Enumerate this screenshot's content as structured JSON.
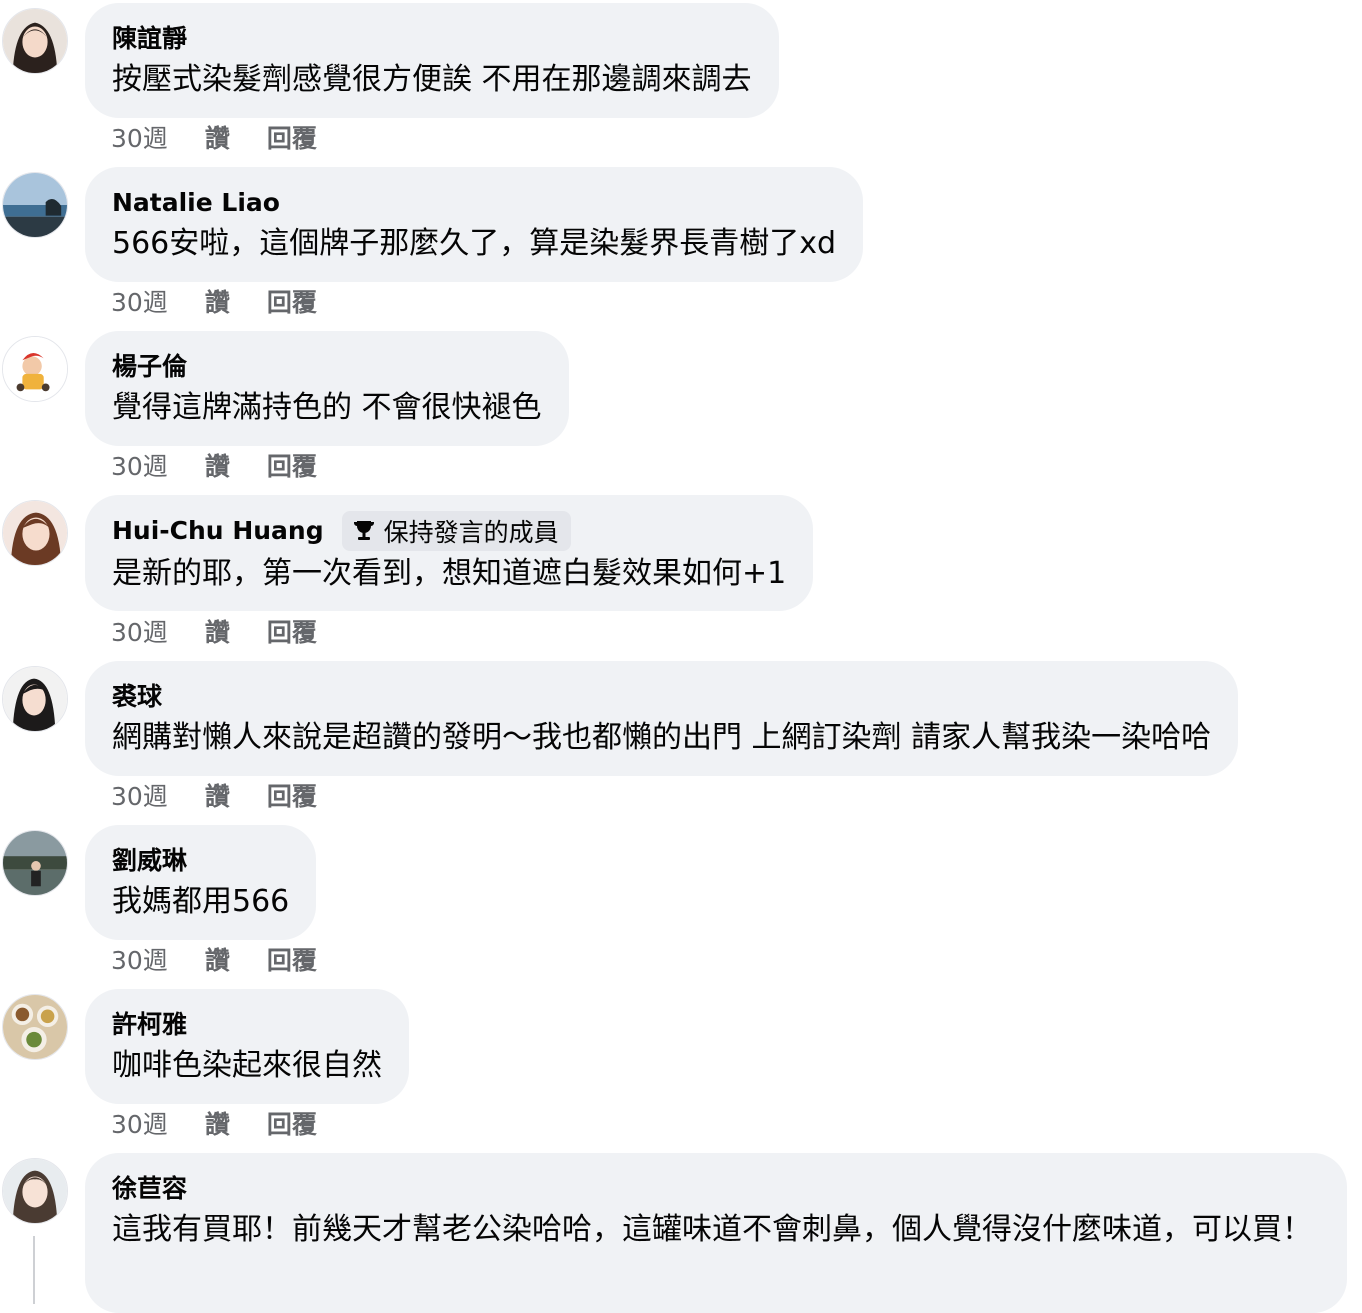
{
  "comments": [
    {
      "author": "陳誼靜",
      "text": "按壓式染髮劑感覺很方便誒 不用在那邊調來調去",
      "time": "30週",
      "like_label": "讚",
      "reply_label": "回覆",
      "avatar": "avatar-woman-long-hair"
    },
    {
      "author": "Natalie Liao",
      "text": "566安啦，這個牌子那麼久了，算是染髮界長青樹了xd",
      "time": "30週",
      "like_label": "讚",
      "reply_label": "回覆",
      "avatar": "avatar-seaside-landscape"
    },
    {
      "author": "楊子倫",
      "text": "覺得這牌滿持色的 不會很快褪色",
      "time": "30週",
      "like_label": "讚",
      "reply_label": "回覆",
      "avatar": "avatar-cartoon-figure"
    },
    {
      "author": "Hui-Chu Huang",
      "badge": "保持發言的成員",
      "badge_icon": "trophy-icon",
      "text": "是新的耶，第一次看到，想知道遮白髮效果如何+1",
      "time": "30週",
      "like_label": "讚",
      "reply_label": "回覆",
      "avatar": "avatar-woman-portrait"
    },
    {
      "author": "裘球",
      "text": "網購對懶人來說是超讚的發明～我也都懶的出門 上網訂染劑 請家人幫我染一染哈哈",
      "time": "30週",
      "like_label": "讚",
      "reply_label": "回覆",
      "avatar": "avatar-woman-dark-hair"
    },
    {
      "author": "劉威琳",
      "text": "我媽都用566",
      "time": "30週",
      "like_label": "讚",
      "reply_label": "回覆",
      "avatar": "avatar-outdoor-person"
    },
    {
      "author": "許柯雅",
      "text": "咖啡色染起來很自然",
      "time": "30週",
      "like_label": "讚",
      "reply_label": "回覆",
      "avatar": "avatar-food-plates"
    },
    {
      "author": "徐苣容",
      "text": "這我有買耶！前幾天才幫老公染哈哈，這罐味道不會刺鼻，個人覺得沒什麼味道，可以買！",
      "avatar": "avatar-woman-bright"
    }
  ],
  "colors": {
    "bubble_bg": "#f0f2f5",
    "secondary_text": "#65676b",
    "primary_text": "#050505",
    "badge_bg": "#e4e6eb"
  }
}
